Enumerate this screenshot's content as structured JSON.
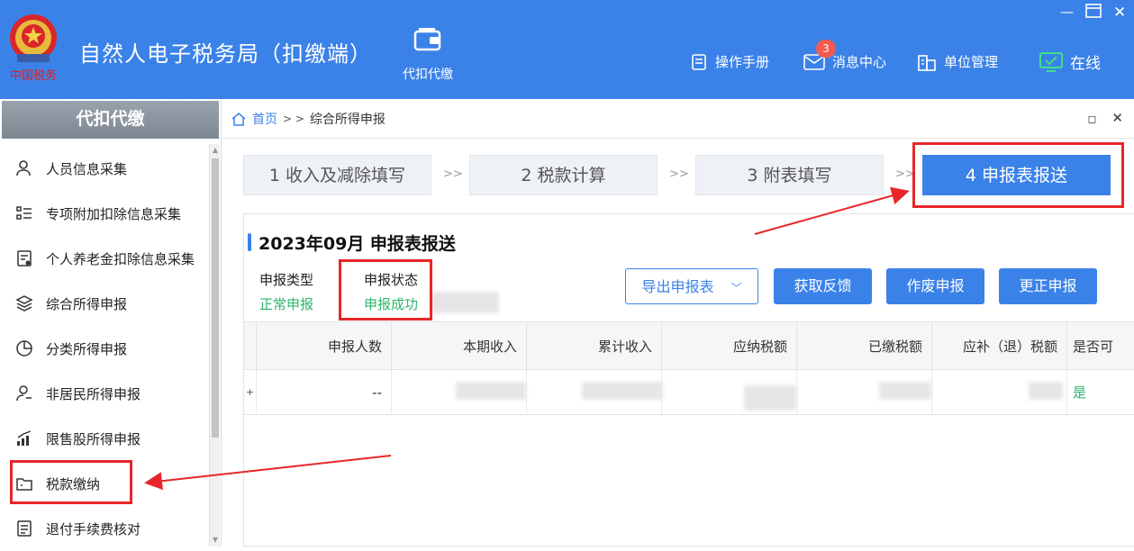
{
  "header": {
    "emblem_text": "中国税务",
    "app_title": "自然人电子税务局（扣缴端）",
    "nav_tile_label": "代扣代缴",
    "links": {
      "manual": "操作手册",
      "messages": "消息中心",
      "message_badge": "3",
      "unit_mgmt": "单位管理",
      "online": "在线"
    }
  },
  "sidebar": {
    "title": "代扣代缴",
    "items": [
      {
        "label": "人员信息采集"
      },
      {
        "label": "专项附加扣除信息采集"
      },
      {
        "label": "个人养老金扣除信息采集"
      },
      {
        "label": "综合所得申报"
      },
      {
        "label": "分类所得申报"
      },
      {
        "label": "非居民所得申报"
      },
      {
        "label": "限售股所得申报"
      },
      {
        "label": "税款缴纳"
      },
      {
        "label": "退付手续费核对"
      }
    ]
  },
  "breadcrumb": {
    "home": "首页",
    "sep": "> >",
    "current": "综合所得申报"
  },
  "steps": [
    {
      "label": "1 收入及减除填写"
    },
    {
      "label": "2 税款计算"
    },
    {
      "label": "3 附表填写"
    },
    {
      "label": "4 申报表报送"
    }
  ],
  "step_sep": ">>",
  "panel": {
    "title": "2023年09月  申报表报送",
    "type_label": "申报类型",
    "type_value": "正常申报",
    "status_label": "申报状态",
    "status_value": "申报成功"
  },
  "buttons": {
    "export": "导出申报表",
    "feedback": "获取反馈",
    "void": "作废申报",
    "correct": "更正申报"
  },
  "table": {
    "headers": [
      "申报人数",
      "本期收入",
      "累计收入",
      "应纳税额",
      "已缴税额",
      "应补（退）税额",
      "是否可"
    ],
    "row": {
      "count": "--",
      "flag": "是"
    },
    "expand": "+"
  },
  "colors": {
    "brand": "#3b82e8",
    "success": "#2fb56b",
    "annotation": "#e8262a"
  }
}
